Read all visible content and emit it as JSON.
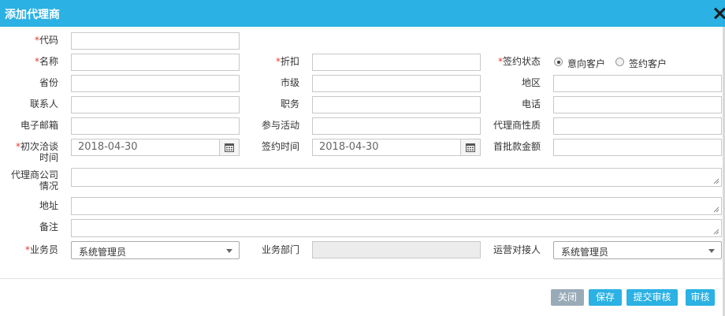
{
  "dialog": {
    "title": "添加代理商"
  },
  "required_mark": "*",
  "fields": {
    "code": {
      "label": "代码",
      "value": ""
    },
    "name": {
      "label": "名称",
      "value": ""
    },
    "discount": {
      "label": "折扣",
      "value": ""
    },
    "sign_status": {
      "label": "签约状态",
      "options": [
        "意向客户",
        "签约客户"
      ],
      "selected": "意向客户"
    },
    "province": {
      "label": "省份",
      "value": ""
    },
    "city": {
      "label": "市级",
      "value": ""
    },
    "region": {
      "label": "地区",
      "value": ""
    },
    "contact": {
      "label": "联系人",
      "value": ""
    },
    "position": {
      "label": "职务",
      "value": ""
    },
    "phone": {
      "label": "电话",
      "value": ""
    },
    "email": {
      "label": "电子邮箱",
      "value": ""
    },
    "activity": {
      "label": "参与活动",
      "value": ""
    },
    "agent_nature": {
      "label": "代理商性质",
      "value": ""
    },
    "first_talk_time": {
      "label_line1": "初次洽谈",
      "label_line2": "时间",
      "value": "2018-04-30"
    },
    "sign_time": {
      "label": "签约时间",
      "value": "2018-04-30"
    },
    "first_payment": {
      "label": "首批款金额",
      "value": ""
    },
    "company_info": {
      "label_line1": "代理商公司",
      "label_line2": "情况",
      "value": ""
    },
    "address": {
      "label": "地址",
      "value": ""
    },
    "remark": {
      "label": "备注",
      "value": ""
    },
    "salesman": {
      "label": "业务员",
      "value": "系统管理员"
    },
    "department": {
      "label": "业务部门",
      "value": ""
    },
    "ops_contact": {
      "label": "运营对接人",
      "value": "系统管理员"
    }
  },
  "buttons": {
    "close": "关闭",
    "save": "保存",
    "submit_review": "提交审核",
    "review": "审核"
  },
  "colors": {
    "title_bar": "#2bb1e3",
    "required": "#e53935",
    "close_button": "#9aabb8"
  }
}
